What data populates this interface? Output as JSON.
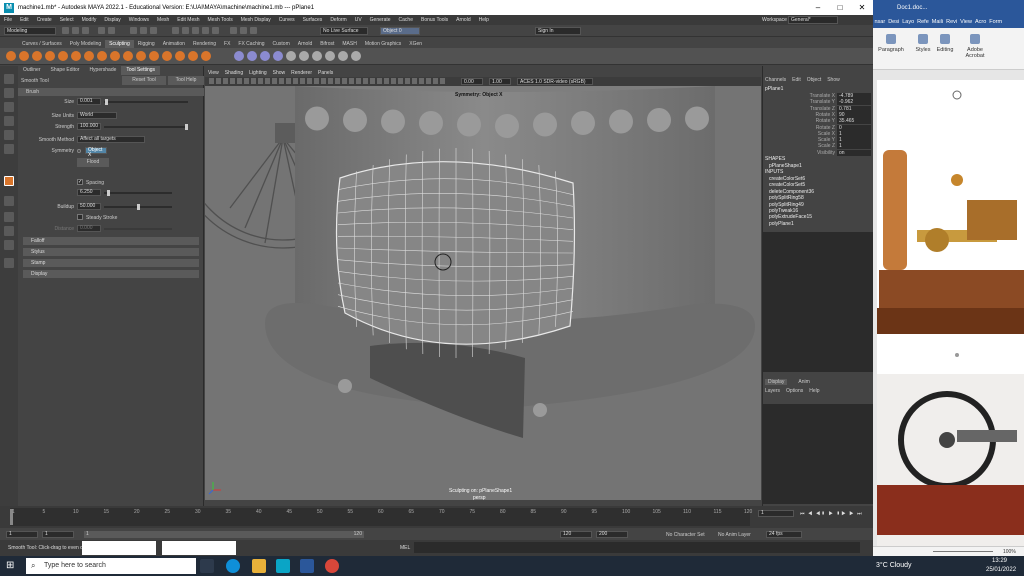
{
  "window": {
    "title": "machine1.mb* - Autodesk MAYA 2022.1 - Educational Version: E:\\UAI\\MAYA\\machine\\machine1.mb   ---   pPlane1"
  },
  "menubar": [
    "File",
    "Edit",
    "Create",
    "Select",
    "Modify",
    "Display",
    "Windows",
    "Mesh",
    "Edit Mesh",
    "Mesh Tools",
    "Mesh Display",
    "Curves",
    "Surfaces",
    "Deform",
    "UV",
    "Generate",
    "Cache",
    "Bonus Tools",
    "Arnold",
    "Help"
  ],
  "workspace": {
    "label": "Workspace :",
    "value": "General*"
  },
  "statusline": {
    "mode": "Modeling",
    "live_surface": "No Live Surface",
    "object": "Object 0",
    "sign_in": "Sign In"
  },
  "shelf_tabs": [
    "Curves / Surfaces",
    "Poly Modeling",
    "Sculpting",
    "Rigging",
    "Animation",
    "Rendering",
    "FX",
    "FX Caching",
    "Custom",
    "Arnold",
    "Bifrost",
    "MASH",
    "Motion Graphics",
    "XGen"
  ],
  "shelf_active": "Sculpting",
  "tool_settings": {
    "tabs": [
      "Outliner",
      "Shape Editor",
      "Hypershade",
      "Tool Settings"
    ],
    "tool_name": "Smooth Tool",
    "reset": "Reset Tool",
    "help": "Tool Help",
    "brush_section": "Brush",
    "size_label": "Size",
    "size_value": "0.001",
    "size_units_label": "Size Units",
    "size_units_value": "World",
    "strength_label": "Strength",
    "strength_value": "100.000",
    "smooth_method_label": "Smooth Method",
    "smooth_method_value": "Affect all targets",
    "symmetry_label": "Symmetry",
    "symmetry_value": "Object X",
    "flood": "Flood",
    "spacing_label": "Spacing",
    "spacing_value": "6.250",
    "buildup_label": "Buildup",
    "buildup_value": "50.000",
    "steady_label": "Steady Stroke",
    "distance_label": "Distance",
    "distance_value": "0.000",
    "sections": [
      "Falloff",
      "Stylus",
      "Stamp",
      "Display"
    ]
  },
  "viewport": {
    "menu": [
      "View",
      "Shading",
      "Lighting",
      "Show",
      "Renderer",
      "Panels"
    ],
    "symmetry_label": "Symmetry: Object X",
    "sculpt_label": "Sculpting on: pPlaneShape1",
    "camera": "persp",
    "field1": "0.00",
    "field2": "1.00",
    "colorspace": "ACES 1.0 SDR-video (sRGB)"
  },
  "channel_box": {
    "menu": [
      "Channels",
      "Edit",
      "Object",
      "Show"
    ],
    "object": "pPlane1",
    "attrs": [
      {
        "n": "Translate X",
        "v": "-4.789"
      },
      {
        "n": "Translate Y",
        "v": "-0.962"
      },
      {
        "n": "Translate Z",
        "v": "0.781"
      },
      {
        "n": "Rotate X",
        "v": "90"
      },
      {
        "n": "Rotate Y",
        "v": "35.465"
      },
      {
        "n": "Rotate Z",
        "v": "0"
      },
      {
        "n": "Scale X",
        "v": "1"
      },
      {
        "n": "Scale Y",
        "v": "1"
      },
      {
        "n": "Scale Z",
        "v": "1"
      },
      {
        "n": "Visibility",
        "v": "on"
      }
    ],
    "shapes_label": "SHAPES",
    "shapes": [
      "pPlaneShape1"
    ],
    "inputs_label": "INPUTS",
    "inputs": [
      "createColorSet6",
      "createColorSet5",
      "deleteComponent36",
      "polySplitRing58",
      "polySplitRing49",
      "polyTweak16",
      "polyExtrudeFace15",
      "polyPlane1"
    ],
    "layer_tabs": [
      "Display",
      "Anim"
    ],
    "layer_menu": [
      "Layers",
      "Options",
      "Help"
    ]
  },
  "timeline": {
    "ticks": [
      "1",
      "5",
      "10",
      "15",
      "20",
      "25",
      "30",
      "35",
      "40",
      "45",
      "50",
      "55",
      "60",
      "65",
      "70",
      "75",
      "80",
      "85",
      "90",
      "95",
      "100",
      "105",
      "110",
      "115",
      "120"
    ],
    "current": "1"
  },
  "range": {
    "start": "1",
    "start2": "1",
    "mid": "1",
    "end_mark": "120",
    "end": "120",
    "end2": "200",
    "char_set": "No Character Set",
    "anim_layer": "No Anim Layer",
    "fps": "24 fps"
  },
  "cmdline": {
    "help": "Smooth Tool: Click-drag to even out vertices",
    "mel": "MEL"
  },
  "word": {
    "title": "Doc1.doc...",
    "ribbon_tabs": [
      "nsar",
      "Desi",
      "Layo",
      "Refe",
      "Maili",
      "Revi",
      "View",
      "Acro",
      "Form"
    ],
    "groups": [
      "Paragraph",
      "Styles",
      "Editing",
      "Adobe Acrobat"
    ],
    "zoom": "100%"
  },
  "taskbar": {
    "search": "Type here to search",
    "weather": "3°C Cloudy",
    "time": "13:29",
    "date": "25/01/2022"
  }
}
